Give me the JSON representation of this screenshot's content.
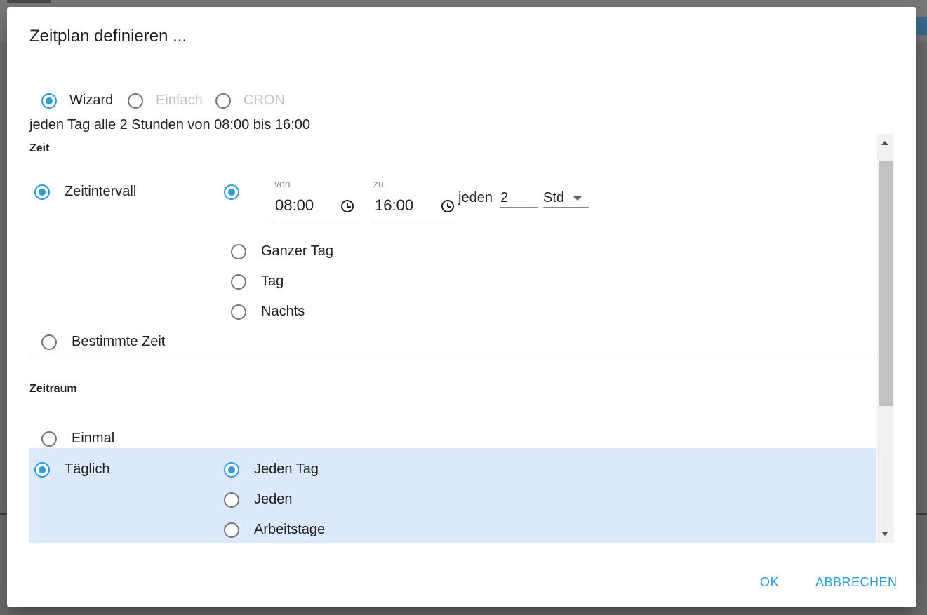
{
  "dialog": {
    "title": "Zeitplan definieren ...",
    "modes": [
      {
        "label": "Wizard",
        "selected": true,
        "disabled": false
      },
      {
        "label": "Einfach",
        "selected": false,
        "disabled": true
      },
      {
        "label": "CRON",
        "selected": false,
        "disabled": true
      }
    ],
    "summary": "jeden Tag alle 2 Stunden von 08:00 bis 16:00",
    "zeit": {
      "title": "Zeit",
      "zeitintervall_label": "Zeitintervall",
      "von_label": "von",
      "von_value": "08:00",
      "zu_label": "zu",
      "zu_value": "16:00",
      "jeden_label": "jeden",
      "jeden_value": "2",
      "unit_value": "Std",
      "options": [
        "Ganzer Tag",
        "Tag",
        "Nachts"
      ],
      "bestimmte_zeit_label": "Bestimmte Zeit"
    },
    "zeitraum": {
      "title": "Zeitraum",
      "einmal_label": "Einmal",
      "taeglich_label": "Täglich",
      "taeglich_options": [
        "Jeden Tag",
        "Jeden",
        "Arbeitstage"
      ]
    },
    "buttons": {
      "ok": "OK",
      "cancel": "ABBRECHEN"
    },
    "colors": {
      "accent": "#2e9bd6",
      "highlight": "#dce8fb"
    }
  }
}
